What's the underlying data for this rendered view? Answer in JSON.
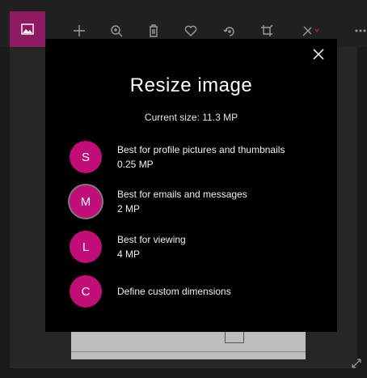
{
  "toolbar": {
    "icons": [
      "gallery-icon",
      "add-icon",
      "zoom-icon",
      "delete-icon",
      "favorite-icon",
      "rotate-icon",
      "crop-icon",
      "edit-icon",
      "more-icon"
    ],
    "accent": "#8e1a63"
  },
  "dialog": {
    "title": "Resize image",
    "current_size": "Current size: 11.3 MP",
    "options": [
      {
        "letter": "S",
        "title": "Best for profile pictures and thumbnails",
        "size": "0.25 MP"
      },
      {
        "letter": "M",
        "title": "Best for emails and messages",
        "size": "2 MP",
        "selected": true
      },
      {
        "letter": "L",
        "title": "Best for viewing",
        "size": "4 MP"
      },
      {
        "letter": "C",
        "title": "Define custom dimensions",
        "size": ""
      }
    ],
    "badge_color": "#c10d77"
  }
}
